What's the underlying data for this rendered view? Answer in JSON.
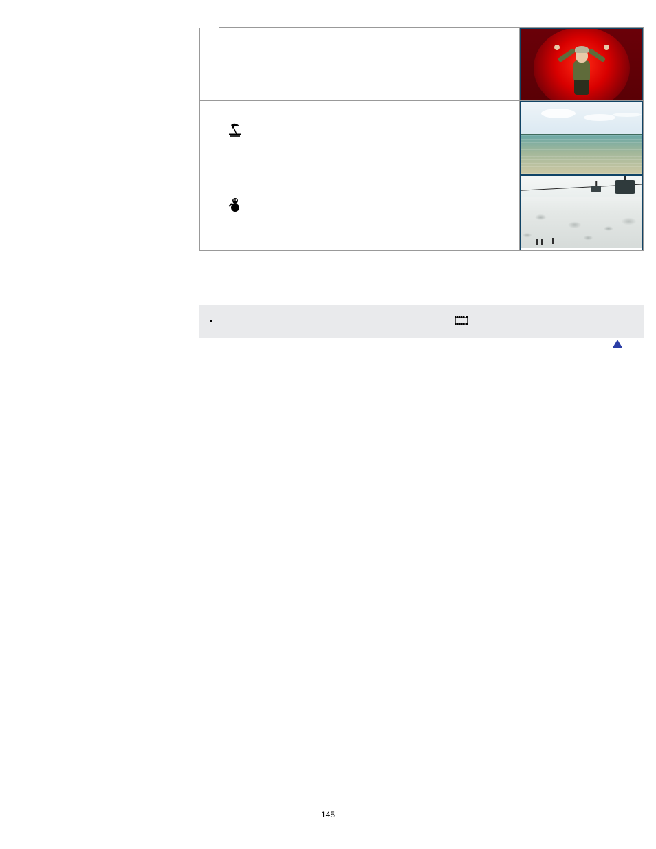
{
  "rows": [
    {
      "icon": "",
      "icon_name": "",
      "image": "spotlight-child"
    },
    {
      "icon": "beach",
      "icon_name": "beach-scene-icon",
      "image": "beach-water"
    },
    {
      "icon": "snow",
      "icon_name": "snow-scene-icon",
      "image": "snow-cablecar"
    }
  ],
  "note": {
    "bullet_text": "",
    "icon_label": "film-strip-icon"
  },
  "back_to_top_label": "back-to-top",
  "page_number": "145"
}
